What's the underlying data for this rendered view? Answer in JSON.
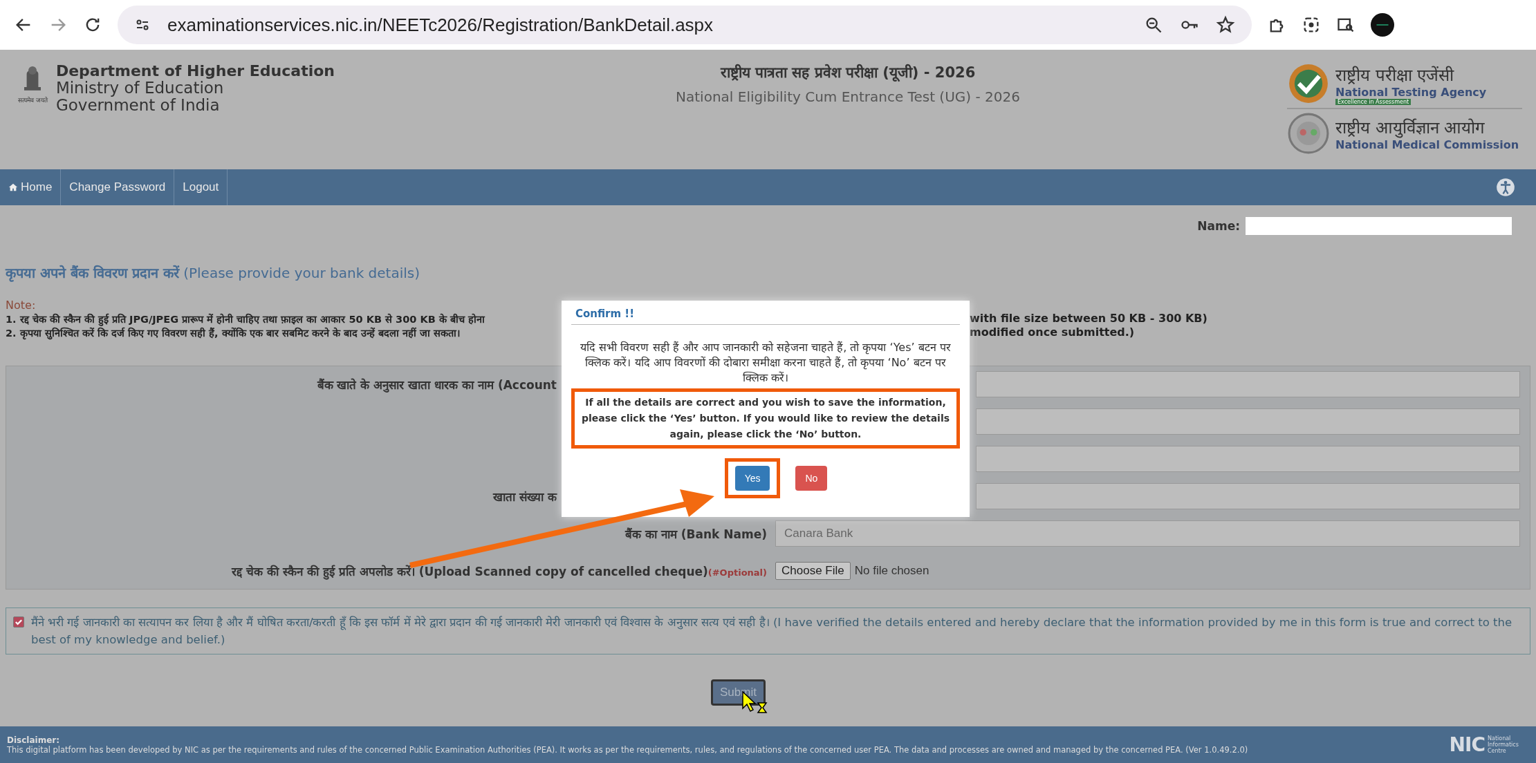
{
  "browser": {
    "url": "examinationservices.nic.in/NEETc2026/Registration/BankDetail.aspx"
  },
  "header": {
    "emblem_motto": "सत्यमेव जयते",
    "dept": [
      "Department of Higher Education",
      "Ministry of Education",
      "Government of India"
    ],
    "title_hindi": "राष्ट्रीय पात्रता सह प्रवेश परीक्षा (यूजी) - 2026",
    "title_english": "National Eligibility Cum Entrance Test (UG) - 2026",
    "nta": {
      "hindi": "राष्ट्रीय परीक्षा एजेंसी",
      "english": "National Testing Agency",
      "tagline": "Excellence in Assessment"
    },
    "nmc": {
      "hindi": "राष्ट्रीय आयुर्विज्ञान आयोग",
      "english": "National Medical Commission"
    }
  },
  "nav": [
    {
      "label": "Home",
      "kind": "home"
    },
    {
      "label": "Change Password",
      "kind": "plain"
    },
    {
      "label": "Logout",
      "kind": "plain"
    }
  ],
  "name_label": "Name:",
  "section_title": {
    "hindi": "कृपया अपने बैंक विवरण प्रदान करें",
    "english": "(Please provide your bank details)"
  },
  "note": {
    "label": "Note:",
    "lines": [
      {
        "left": "1. रद्द चेक की स्कैन की हुई प्रति JPG/JPEG प्रारूप में होनी चाहिए तथा फ़ाइल का आकार 50 KB से 300 KB के बीच होना",
        "right": "with file size between 50 KB - 300 KB)"
      },
      {
        "left": "2. कृपया सुनिश्चित करें कि दर्ज किए गए विवरण सही हैं, क्योंकि एक बार सबमिट करने के बाद उन्हें बदला नहीं जा सकता।",
        "right": "modified once submitted.)"
      }
    ]
  },
  "form_rows": [
    {
      "kind": "covered",
      "label": "बैंक खाते के अनुसार खाता धारक का नाम (Account"
    },
    {
      "kind": "covered"
    },
    {
      "kind": "covered"
    },
    {
      "kind": "covered",
      "label": "खाता संख्या क"
    },
    {
      "kind": "text",
      "label": "बैंक का नाम (Bank Name)",
      "value": "Canara Bank"
    },
    {
      "kind": "file",
      "label": "रद्द चेक की स्कैन की हुई प्रति अपलोड करें। (Upload Scanned copy of cancelled cheque)",
      "optional": "(#Optional)",
      "button": "Choose File",
      "status": "No file chosen"
    }
  ],
  "declaration": {
    "checked": true,
    "text": "मैंने भरी गई जानकारी का सत्यापन कर लिया है और मैं घोषित करता/करती हूँ कि इस फॉर्म में मेरे द्वारा प्रदान की गई जानकारी मेरी जानकारी एवं विश्वास के अनुसार सत्य एवं सही है। (I have verified the details entered and hereby declare that the information provided by me in this form is true and correct to the best of my knowledge and belief.)"
  },
  "submit": "Submit",
  "footer": {
    "title": "Disclaimer:",
    "text": "This digital platform has been developed by NIC as per the requirements and rules of the concerned Public Examination Authorities (PEA). It works as per the requirements, rules, and regulations of the concerned user PEA. The data and processes are owned and managed by the concerned PEA. (Ver 1.0.49.2.0)",
    "logo": "NIC",
    "logo_caption": "National Informatics Centre"
  },
  "dialog": {
    "title": "Confirm !!",
    "hindi": "यदि सभी विवरण सही हैं और आप जानकारी को सहेजना चाहते हैं, तो कृपया ‘Yes’ बटन पर क्लिक करें। यदि आप विवरणों की दोबारा समीक्षा करना चाहते हैं, तो कृपया ‘No’ बटन पर क्लिक करें।",
    "english": "If all the details are correct and you wish to save the information, please click the ‘Yes’ button. If you would like to review the details again, please click the ‘No’ button.",
    "buttons": [
      {
        "label": "Yes",
        "kind": "primary"
      },
      {
        "label": "No",
        "kind": "danger"
      }
    ]
  }
}
